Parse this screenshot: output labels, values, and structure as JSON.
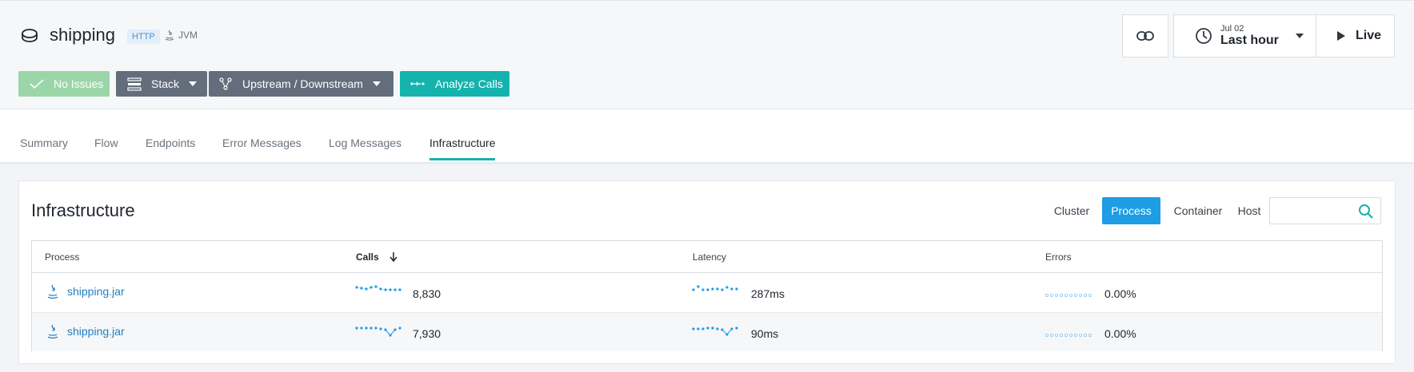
{
  "header": {
    "service_icon": "database-icon",
    "title": "shipping",
    "tag_http": "HTTP",
    "tag_jvm": "JVM",
    "tag_jvm_icon": "java-icon",
    "buttons": {
      "no_issues": "No Issues",
      "stack": "Stack",
      "upstream_downstream": "Upstream / Downstream",
      "analyze_calls": "Analyze Calls"
    },
    "time": {
      "date": "Jul 02",
      "range": "Last hour",
      "live": "Live"
    }
  },
  "tabs": [
    {
      "label": "Summary"
    },
    {
      "label": "Flow"
    },
    {
      "label": "Endpoints"
    },
    {
      "label": "Error Messages"
    },
    {
      "label": "Log Messages"
    },
    {
      "label": "Infrastructure",
      "active": true
    }
  ],
  "infrastructure": {
    "title": "Infrastructure",
    "segments": [
      "Cluster",
      "Process",
      "Container",
      "Host"
    ],
    "active_segment": "Process",
    "search": {
      "value": "",
      "placeholder": ""
    },
    "columns": {
      "process": "Process",
      "calls": "Calls",
      "latency": "Latency",
      "errors": "Errors"
    },
    "rows": [
      {
        "process": "shipping.jar",
        "calls": "8,830",
        "latency": "287ms",
        "errors": "0.00%"
      },
      {
        "process": "shipping.jar",
        "calls": "7,930",
        "latency": "90ms",
        "errors": "0.00%"
      }
    ]
  },
  "colors": {
    "accent_teal": "#15b3ad",
    "active_blue": "#1e9ce4",
    "no_issues_green": "#9bd6a9",
    "button_gray": "#636d7c",
    "link_blue": "#1e7fbf"
  }
}
